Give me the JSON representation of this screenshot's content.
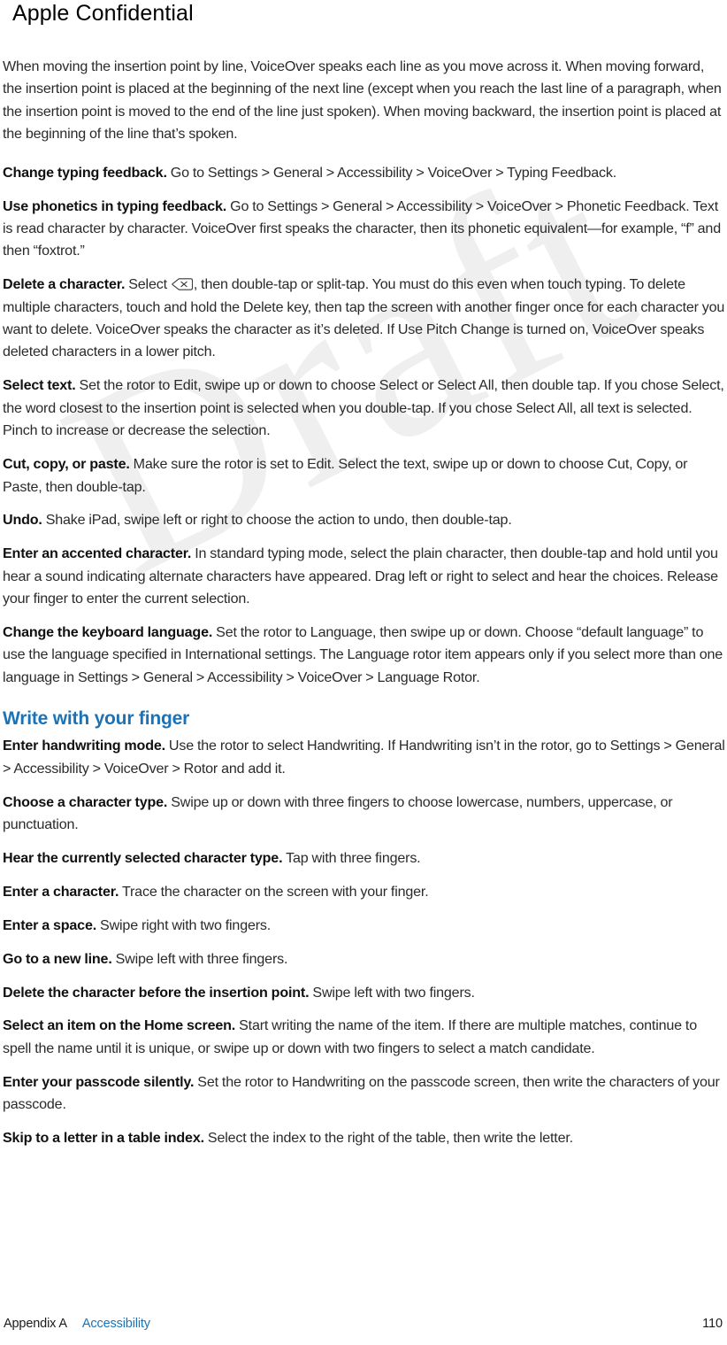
{
  "header": {
    "confidential_label": "Apple Confidential"
  },
  "watermark": {
    "text": "Draft",
    "color": "#efefef"
  },
  "theme": {
    "link_blue": "#1a73b8",
    "body_text": "#2a2a2a",
    "bold_text": "#111111"
  },
  "content": {
    "intro_paragraph": "When moving the insertion point by line, VoiceOver speaks each line as you move across it. When moving forward, the insertion point is placed at the beginning of the next line (except when you reach the last line of a paragraph, when the insertion point is moved to the end of the line just spoken). When moving backward, the insertion point is placed at the beginning of the line that’s spoken.",
    "entries": [
      {
        "term": "Change typing feedback.",
        "body": "Go to Settings > General > Accessibility > VoiceOver > Typing Feedback."
      },
      {
        "term": "Use phonetics in typing feedback.",
        "body": "Go to Settings > General > Accessibility > VoiceOver > Phonetic Feedback. Text is read character by character. VoiceOver first speaks the character, then its phonetic equivalent—for example, “f” and then “foxtrot.”"
      },
      {
        "term": "Delete a character.",
        "body_before_icon": "Select ",
        "icon": "delete-key-icon",
        "body_after_icon": ", then double-tap or split-tap. You must do this even when touch typing. To delete multiple characters, touch and hold the Delete key, then tap the screen with another finger once for each character you want to delete. VoiceOver speaks the character as it’s deleted. If Use Pitch Change is turned on, VoiceOver speaks deleted characters in a lower pitch."
      },
      {
        "term": "Select text.",
        "body": "Set the rotor to Edit, swipe up or down to choose Select or Select All, then double tap. If you chose Select, the word closest to the insertion point is selected when you double-tap. If you chose Select All, all text is selected. Pinch to increase or decrease the selection."
      },
      {
        "term": "Cut, copy, or paste.",
        "body": "Make sure the rotor is set to Edit. Select the text, swipe up or down to choose Cut, Copy, or Paste, then double-tap."
      },
      {
        "term": "Undo.",
        "body": "Shake iPad, swipe left or right to choose the action to undo, then double-tap."
      },
      {
        "term": "Enter an accented character.",
        "body": "In standard typing mode, select the plain character, then double-tap and hold until you hear a sound indicating alternate characters have appeared. Drag left or right to select and hear the choices. Release your finger to enter the current selection."
      },
      {
        "term": "Change the keyboard language.",
        "body": "Set the rotor to Language, then swipe up or down. Choose “default language” to use the language specified in International settings. The Language rotor item appears only if you select more than one language in Settings > General > Accessibility > VoiceOver > Language Rotor."
      }
    ],
    "section_heading": "Write with your finger",
    "section_entries": [
      {
        "term": "Enter handwriting mode.",
        "body": "Use the rotor to select Handwriting. If Handwriting isn’t in the rotor, go to Settings > General > Accessibility > VoiceOver > Rotor and add it."
      },
      {
        "term": "Choose a character type.",
        "body": "Swipe up or down with three fingers to choose lowercase, numbers, uppercase, or punctuation."
      },
      {
        "term": "Hear the currently selected character type.",
        "body": "Tap with three fingers."
      },
      {
        "term": "Enter a character.",
        "body": "Trace the character on the screen with your finger."
      },
      {
        "term": "Enter a space.",
        "body": "Swipe right with two fingers."
      },
      {
        "term": "Go to a new line.",
        "body": "Swipe left with three fingers."
      },
      {
        "term": "Delete the character before the insertion point.",
        "body": "Swipe left with two fingers."
      },
      {
        "term": "Select an item on the Home screen.",
        "body": "Start writing the name of the item. If there are multiple matches, continue to spell the name until it is unique, or swipe up or down with two fingers to select a match candidate."
      },
      {
        "term": "Enter your passcode silently.",
        "body": "Set the rotor to Handwriting on the passcode screen, then write the characters of your passcode."
      },
      {
        "term": "Skip to a letter in a table index.",
        "body": "Select the index to the right of the table, then write the letter."
      }
    ]
  },
  "footer": {
    "appendix_label": "Appendix A",
    "chapter_link": "Accessibility",
    "page_number": "110"
  }
}
